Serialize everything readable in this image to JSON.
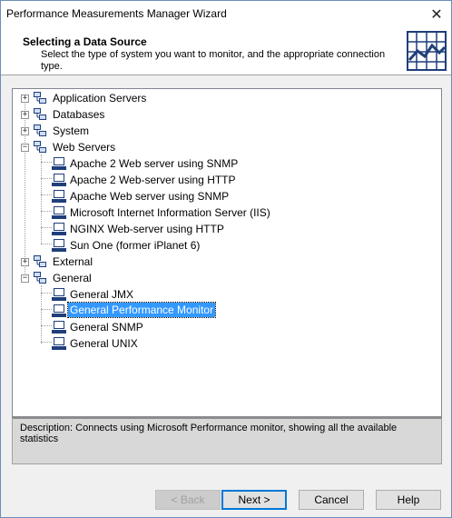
{
  "window": {
    "title": "Performance Measurements Manager Wizard",
    "close_label": "✕"
  },
  "header": {
    "title": "Selecting a Data Source",
    "subtitle": "Select the type of system you want to monitor, and the appropriate connection type."
  },
  "tree": {
    "groups": [
      {
        "label": "Application Servers",
        "expander": "+"
      },
      {
        "label": "Databases",
        "expander": "+"
      },
      {
        "label": "System",
        "expander": "+"
      },
      {
        "label": "Web Servers",
        "expander": "−"
      },
      {
        "label": "External",
        "expander": "+"
      },
      {
        "label": "General",
        "expander": "−"
      }
    ],
    "web_servers": [
      "Apache 2 Web server using SNMP",
      "Apache 2 Web-server using HTTP",
      "Apache Web server using SNMP",
      "Microsoft Internet Information Server (IIS)",
      "NGINX Web-server using HTTP",
      "Sun One (former iPlanet 6)"
    ],
    "general": [
      "General JMX",
      "General Performance Monitor",
      "General SNMP",
      "General UNIX"
    ],
    "selected": "General Performance Monitor"
  },
  "description": "Description: Connects using Microsoft Performance monitor, showing all the available statistics",
  "buttons": {
    "back": "< Back",
    "next": "Next >",
    "cancel": "Cancel",
    "help": "Help"
  },
  "colors": {
    "selection": "#3399ff",
    "default_button_border": "#0078d7"
  },
  "icons": {
    "folder": "folder-network-icon",
    "computer": "computer-icon",
    "header": "chart-icon"
  }
}
